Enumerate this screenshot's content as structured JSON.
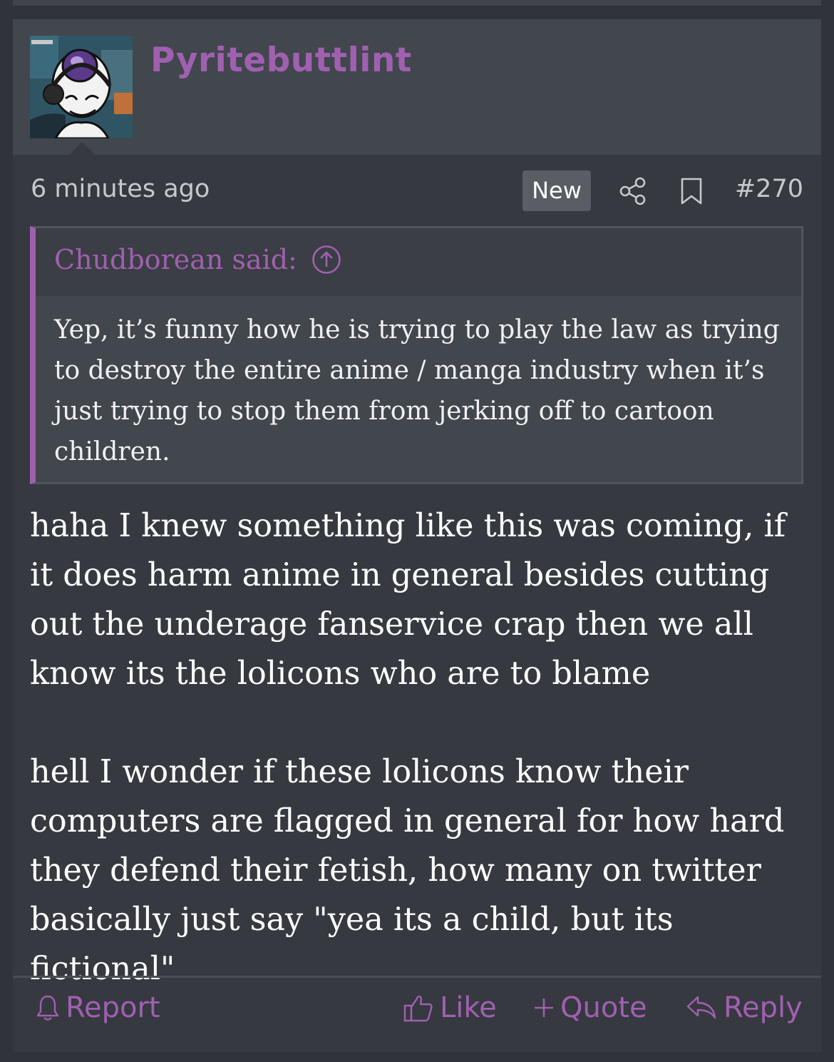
{
  "post": {
    "username": "Pyritebuttlint",
    "time": "6 minutes ago",
    "badge": "New",
    "post_number": "#270",
    "quote": {
      "attribution": "Chudborean said:",
      "text": "Yep, it’s funny how he is trying to play the law as trying to destroy the entire anime / manga industry when it’s just trying to stop them from jerking off to cartoon children."
    },
    "message": {
      "paragraph_1": "haha I knew something like this was coming, if it does harm anime in general besides cutting out the underage fanservice crap then we all know its the lolicons who are to blame",
      "paragraph_2": "hell I wonder if these lolicons know their computers are flagged in general for how hard they defend their fetish, how many on twitter basically just say \"yea its a child, but its fictional\""
    },
    "actions": {
      "report": "Report",
      "like": "Like",
      "quote": "Quote",
      "reply": "Reply"
    }
  },
  "icons": {
    "share": "share-icon",
    "bookmark": "bookmark-icon",
    "jump_to_quote": "arrow-up-circle-icon",
    "report": "bell-icon",
    "like": "thumbs-up-icon",
    "quote": "plus-icon",
    "reply": "reply-arrow-icon"
  },
  "colors": {
    "accent": "#a060b0",
    "background": "#30343a",
    "post_background": "#363940",
    "header_background": "#42464d",
    "text": "#ffffff"
  }
}
